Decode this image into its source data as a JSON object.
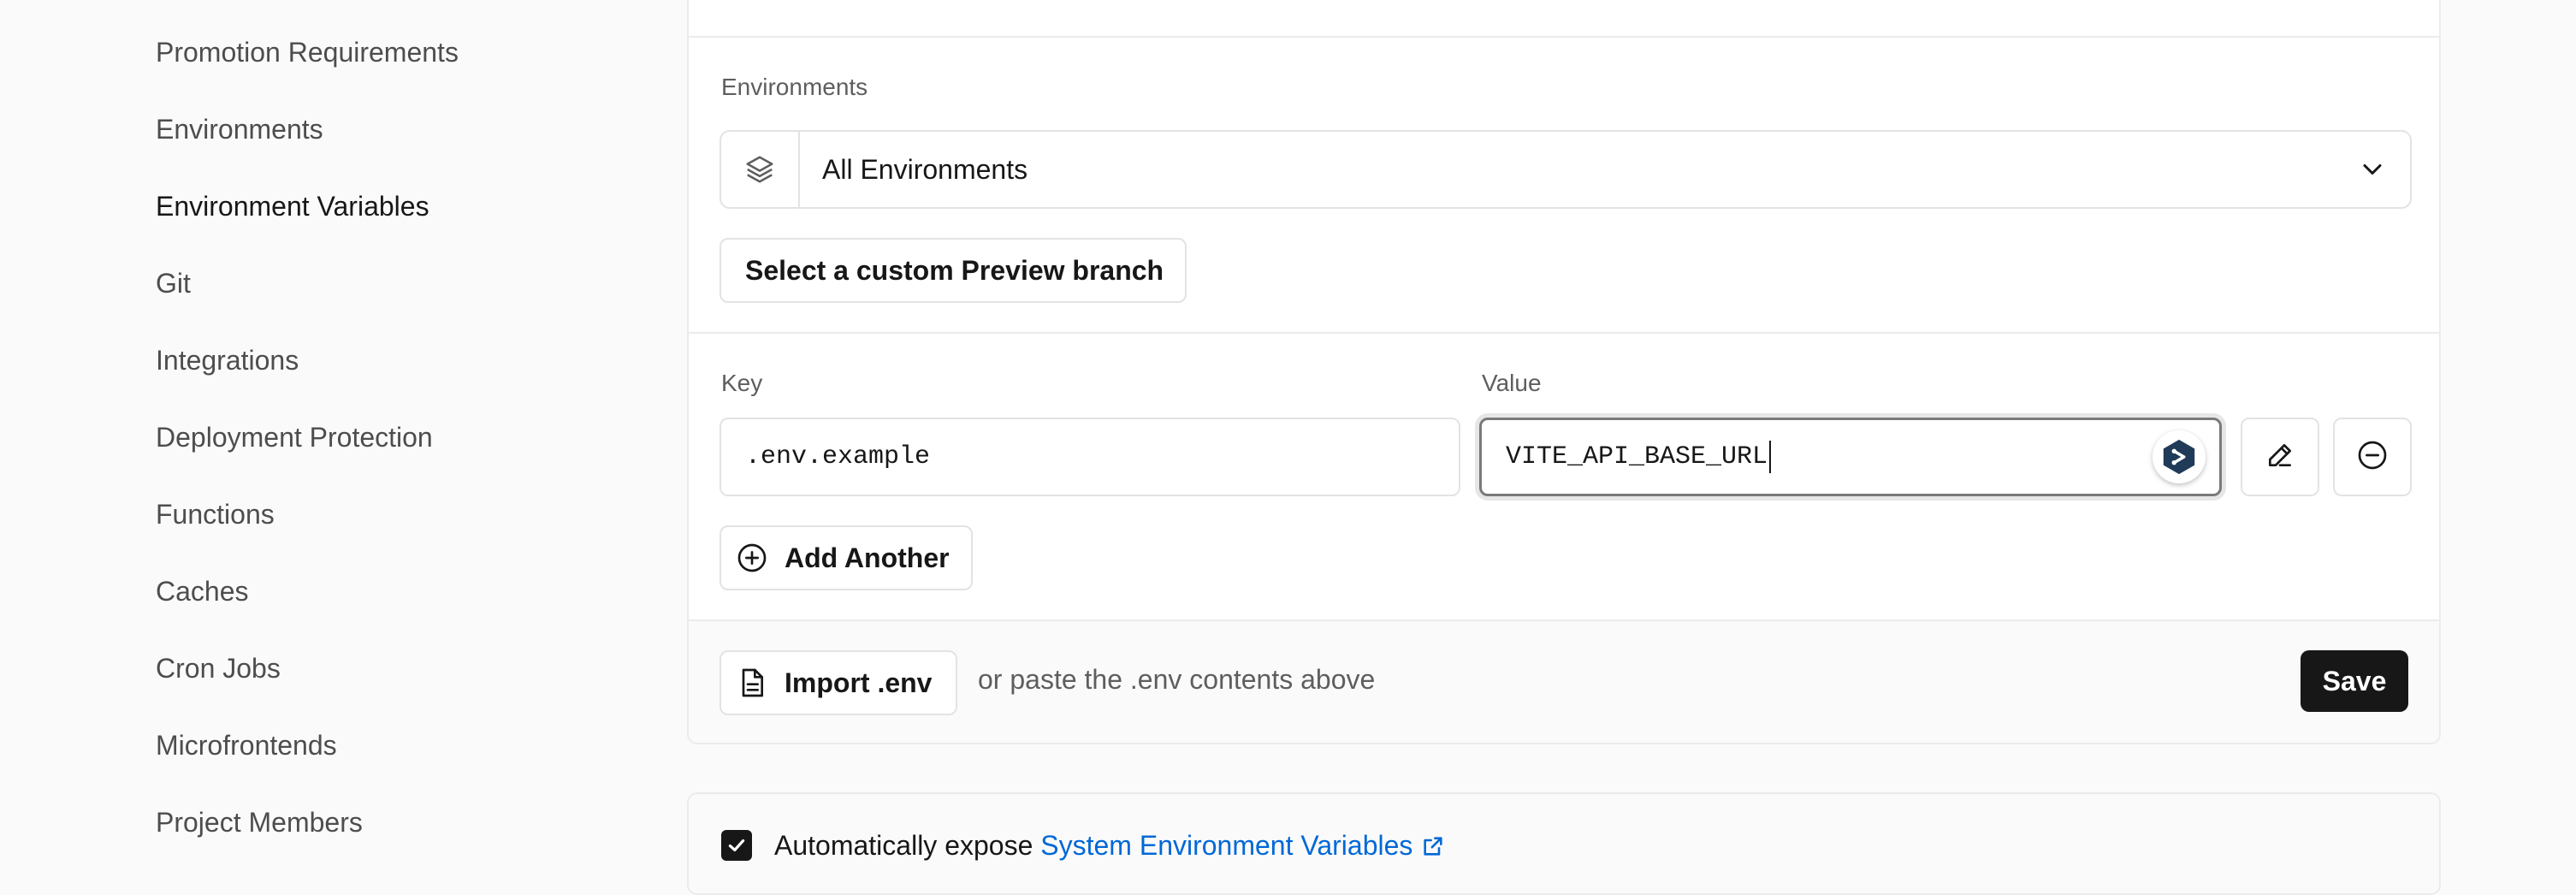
{
  "sidebar": {
    "items": [
      {
        "label": "Promotion Requirements"
      },
      {
        "label": "Environments"
      },
      {
        "label": "Environment Variables",
        "active": true
      },
      {
        "label": "Git"
      },
      {
        "label": "Integrations"
      },
      {
        "label": "Deployment Protection"
      },
      {
        "label": "Functions"
      },
      {
        "label": "Caches"
      },
      {
        "label": "Cron Jobs"
      },
      {
        "label": "Microfrontends"
      },
      {
        "label": "Project Members"
      }
    ]
  },
  "form": {
    "environments_label": "Environments",
    "environments_select": {
      "value": "All Environments",
      "icon": "layers-icon"
    },
    "custom_branch_button": "Select a custom Preview branch",
    "key_label": "Key",
    "value_label": "Value",
    "key_input": {
      "value": ".env.example"
    },
    "value_input": {
      "value": "VITE_API_BASE_URL"
    },
    "add_another_button": "Add Another",
    "import_button": "Import .env",
    "paste_hint": "or paste the .env contents above",
    "save_button": "Save"
  },
  "system_env": {
    "checked": true,
    "text_prefix": "Automatically expose ",
    "link_text": "System Environment Variables"
  },
  "colors": {
    "accent_link": "#0068d6",
    "primary_button": "#171717",
    "extension_badge": "#1f3b57"
  }
}
